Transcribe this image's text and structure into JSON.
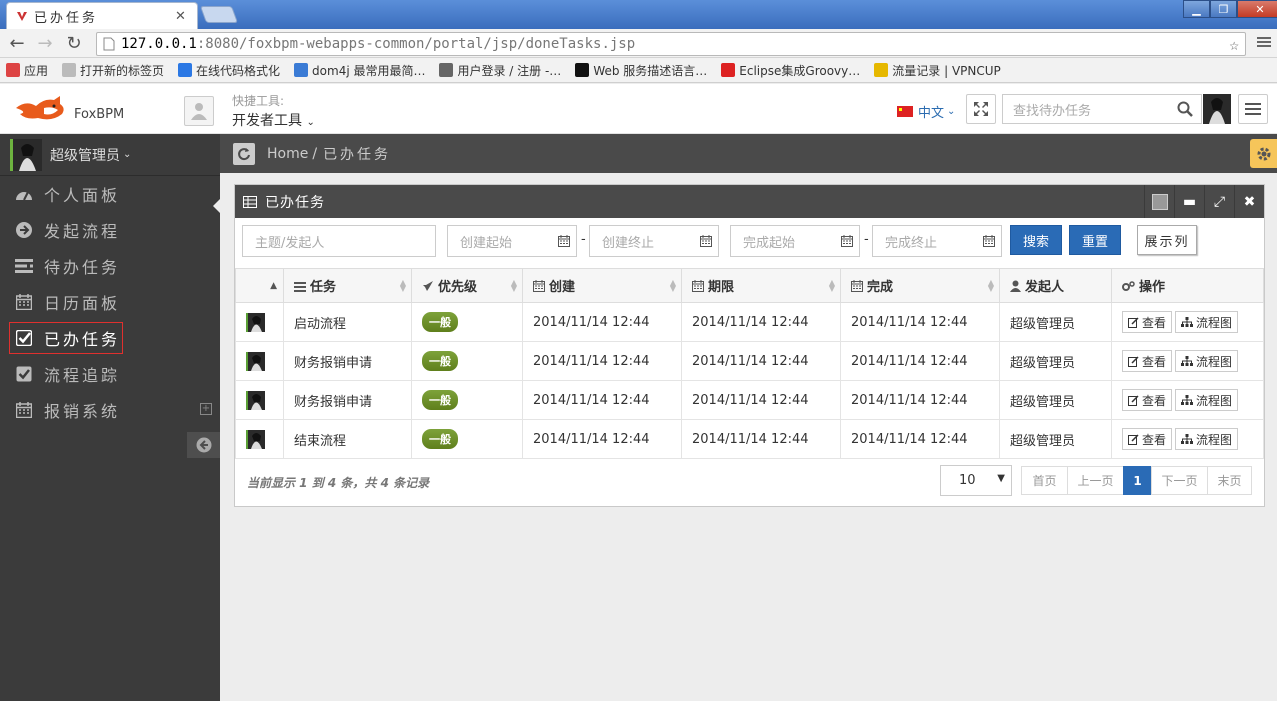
{
  "browser": {
    "tab_title": "已办任务",
    "url_host": "127.0.0.1",
    "url_rest": ":8080/foxbpm-webapps-common/portal/jsp/doneTasks.jsp",
    "bookmarks": [
      {
        "label": "应用",
        "color": "#d44"
      },
      {
        "label": "打开新的标签页",
        "color": "#bbb"
      },
      {
        "label": "在线代码格式化",
        "color": "#2b78e4"
      },
      {
        "label": "dom4j 最常用最简…",
        "color": "#3a7bd5"
      },
      {
        "label": "用户登录 / 注册 -…",
        "color": "#666"
      },
      {
        "label": "Web 服务描述语言…",
        "color": "#111"
      },
      {
        "label": "Eclipse集成Groovy…",
        "color": "#d22"
      },
      {
        "label": "流量记录 | VPNCUP",
        "color": "#e6b800"
      }
    ]
  },
  "header": {
    "brand": "FoxBPM",
    "quick_label": "快捷工具:",
    "quick_value": "开发者工具",
    "language": "中文",
    "search_placeholder": "查找待办任务"
  },
  "sidebar": {
    "user_name": "超级管理员",
    "items": [
      {
        "label": "个人面板",
        "icon": "dashboard-icon"
      },
      {
        "label": "发起流程",
        "icon": "arrow-circle-icon"
      },
      {
        "label": "待办任务",
        "icon": "tasks-icon"
      },
      {
        "label": "日历面板",
        "icon": "calendar-icon"
      },
      {
        "label": "已办任务",
        "icon": "check-square-icon"
      },
      {
        "label": "流程追踪",
        "icon": "check-square-icon"
      },
      {
        "label": "报销系统",
        "icon": "calendar-icon"
      }
    ]
  },
  "breadcrumb": {
    "home": "Home",
    "separator": "/",
    "current": "已办任务"
  },
  "panel": {
    "title": "已办任务",
    "filters": {
      "subject_placeholder": "主题/发起人",
      "create_start": "创建起始",
      "create_end": "创建终止",
      "finish_start": "完成起始",
      "finish_end": "完成终止",
      "dash": "-",
      "search_button": "搜索",
      "reset_button": "重置",
      "columns_button": "展示列"
    },
    "table": {
      "headers": [
        "任务",
        "优先级",
        "创建",
        "期限",
        "完成",
        "发起人",
        "操作"
      ],
      "rows": [
        {
          "task": "启动流程",
          "priority": "一般",
          "created": "2014/11/14 12:44",
          "deadline": "2014/11/14 12:44",
          "finished": "2014/11/14 12:44",
          "initiator": "超级管理员"
        },
        {
          "task": "财务报销申请",
          "priority": "一般",
          "created": "2014/11/14 12:44",
          "deadline": "2014/11/14 12:44",
          "finished": "2014/11/14 12:44",
          "initiator": "超级管理员"
        },
        {
          "task": "财务报销申请",
          "priority": "一般",
          "created": "2014/11/14 12:44",
          "deadline": "2014/11/14 12:44",
          "finished": "2014/11/14 12:44",
          "initiator": "超级管理员"
        },
        {
          "task": "结束流程",
          "priority": "一般",
          "created": "2014/11/14 12:44",
          "deadline": "2014/11/14 12:44",
          "finished": "2014/11/14 12:44",
          "initiator": "超级管理员"
        }
      ],
      "view_label": "查看",
      "diagram_label": "流程图"
    },
    "footer": {
      "info": "当前显示 1 到 4 条，共 4 条记录",
      "page_size": "10",
      "pager": [
        "首页",
        "上一页",
        "1",
        "下一页",
        "末页"
      ]
    }
  },
  "colors": {
    "sidebar_bg": "#3b3b3b",
    "primary_blue": "#2a6bb6",
    "badge_green": "#6b8e23",
    "active_outline": "#e0302e"
  }
}
